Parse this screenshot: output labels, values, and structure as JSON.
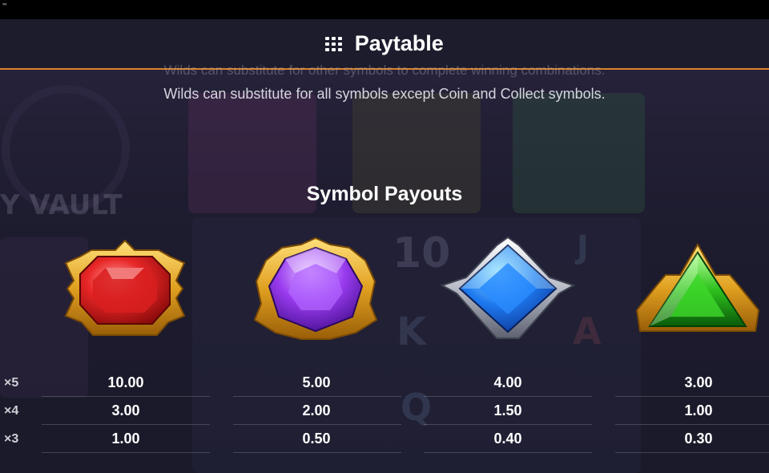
{
  "trademark": "™",
  "header": {
    "title": "Paytable",
    "menu_icon": "grid-menu-icon"
  },
  "ghost_text": "Wilds can substitute for other symbols to complete winning combinations.",
  "wilds_text": "Wilds can substitute for all symbols except Coin and Collect symbols.",
  "section_title": "Symbol Payouts",
  "colors": {
    "accent": "#d9822b",
    "background": "#1a1a2c"
  },
  "multipliers": [
    "×5",
    "×4",
    "×3"
  ],
  "symbols": [
    {
      "name": "red-gem",
      "payouts": [
        "10.00",
        "3.00",
        "1.00"
      ]
    },
    {
      "name": "purple-gem",
      "payouts": [
        "5.00",
        "2.00",
        "0.50"
      ]
    },
    {
      "name": "blue-gem",
      "payouts": [
        "4.00",
        "1.50",
        "0.40"
      ]
    },
    {
      "name": "green-gem",
      "payouts": [
        "3.00",
        "1.00",
        "0.30"
      ]
    }
  ]
}
